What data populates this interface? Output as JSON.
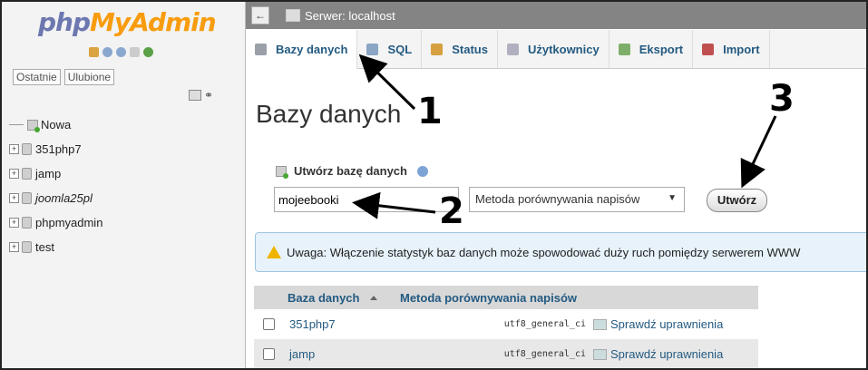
{
  "sidebar": {
    "logo_php": "php",
    "logo_my": "MyAdmin",
    "tabs": [
      "Ostatnie",
      "Ulubione"
    ],
    "tree": [
      {
        "label": "Nowa",
        "type": "new"
      },
      {
        "label": "351php7",
        "type": "db"
      },
      {
        "label": "jamp",
        "type": "db"
      },
      {
        "label": "joomla25pl",
        "type": "db"
      },
      {
        "label": "phpmyadmin",
        "type": "db"
      },
      {
        "label": "test",
        "type": "db"
      }
    ]
  },
  "serverbar": {
    "back": "←",
    "label": "Serwer: localhost"
  },
  "tabs": [
    {
      "label": "Bazy danych",
      "active": true,
      "icon_color": "#9aa0a8"
    },
    {
      "label": "SQL",
      "icon_color": "#8aa6c4"
    },
    {
      "label": "Status",
      "icon_color": "#d6a040"
    },
    {
      "label": "Użytkownicy",
      "icon_color": "#b0b0c0"
    },
    {
      "label": "Eksport",
      "icon_color": "#7fae6a"
    },
    {
      "label": "Import",
      "icon_color": "#c05050"
    }
  ],
  "main": {
    "title": "Bazy danych",
    "create_label": "Utwórz bazę danych",
    "db_name_value": "mojeebooki",
    "collation_placeholder": "Metoda porównywania napisów",
    "create_button": "Utwórz",
    "notice": "Uwaga: Włączenie statystyk baz danych może spowodować duży ruch pomiędzy serwerem WWW"
  },
  "table": {
    "headers": {
      "name": "Baza danych",
      "collation": "Metoda porównywania napisów"
    },
    "rows": [
      {
        "name": "351php7",
        "collation": "utf8_general_ci",
        "action": "Sprawdź uprawnienia"
      },
      {
        "name": "jamp",
        "collation": "utf8_general_ci",
        "action": "Sprawdź uprawnienia"
      }
    ]
  },
  "annotations": [
    "1",
    "2",
    "3"
  ]
}
